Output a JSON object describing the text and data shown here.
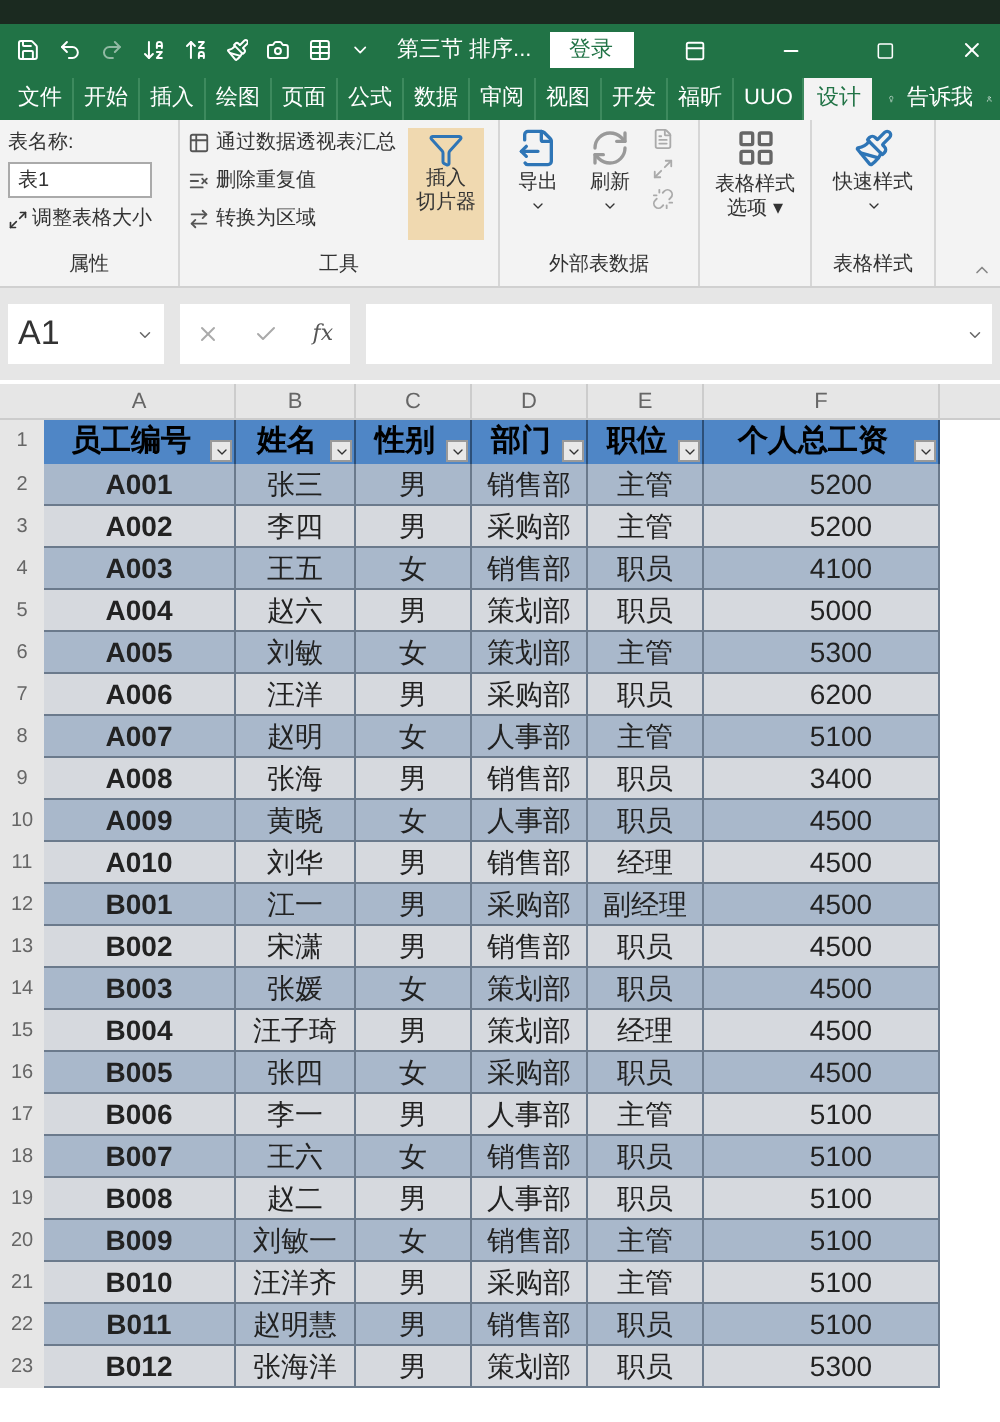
{
  "title_bar": {
    "title": "第三节 排序...",
    "login_button": "登录"
  },
  "ribbon_tabs": [
    {
      "label": "文件",
      "selected": false
    },
    {
      "label": "开始",
      "selected": false
    },
    {
      "label": "插入",
      "selected": false
    },
    {
      "label": "绘图",
      "selected": false
    },
    {
      "label": "页面",
      "selected": false
    },
    {
      "label": "公式",
      "selected": false
    },
    {
      "label": "数据",
      "selected": false
    },
    {
      "label": "审阅",
      "selected": false
    },
    {
      "label": "视图",
      "selected": false
    },
    {
      "label": "开发",
      "selected": false
    },
    {
      "label": "福昕",
      "selected": false
    },
    {
      "label": "UUO",
      "selected": false
    },
    {
      "label": "设计",
      "selected": true
    }
  ],
  "tell_me": "告诉我",
  "ribbon": {
    "properties": {
      "name_label": "表名称:",
      "name_value": "表1",
      "resize": "调整表格大小",
      "group_label": "属性"
    },
    "tools": {
      "items": [
        "通过数据透视表汇总",
        "删除重复值",
        "转换为区域"
      ],
      "slicer_line1": "插入",
      "slicer_line2": "切片器",
      "group_label": "工具"
    },
    "external": {
      "export": "导出",
      "refresh": "刷新",
      "group_label": "外部表数据"
    },
    "style_options": {
      "line1": "表格样式",
      "line2": "选项 ▾"
    },
    "styles": {
      "quick": "快速样式",
      "group_label": "表格样式"
    }
  },
  "formula_bar": {
    "name_box": "A1",
    "function_label": "fx"
  },
  "sheet": {
    "column_letters": [
      "A",
      "B",
      "C",
      "D",
      "E",
      "F"
    ],
    "header_row_number": "1",
    "columns": [
      "员工编号",
      "姓名",
      "性别",
      "部门",
      "职位",
      "个人总工资"
    ],
    "rows": [
      {
        "number": "2",
        "cells": [
          "A001",
          "张三",
          "男",
          "销售部",
          "主管",
          "5200"
        ]
      },
      {
        "number": "3",
        "cells": [
          "A002",
          "李四",
          "男",
          "采购部",
          "主管",
          "5200"
        ]
      },
      {
        "number": "4",
        "cells": [
          "A003",
          "王五",
          "女",
          "销售部",
          "职员",
          "4100"
        ]
      },
      {
        "number": "5",
        "cells": [
          "A004",
          "赵六",
          "男",
          "策划部",
          "职员",
          "5000"
        ]
      },
      {
        "number": "6",
        "cells": [
          "A005",
          "刘敏",
          "女",
          "策划部",
          "主管",
          "5300"
        ]
      },
      {
        "number": "7",
        "cells": [
          "A006",
          "汪洋",
          "男",
          "采购部",
          "职员",
          "6200"
        ]
      },
      {
        "number": "8",
        "cells": [
          "A007",
          "赵明",
          "女",
          "人事部",
          "主管",
          "5100"
        ]
      },
      {
        "number": "9",
        "cells": [
          "A008",
          "张海",
          "男",
          "销售部",
          "职员",
          "3400"
        ]
      },
      {
        "number": "10",
        "cells": [
          "A009",
          "黄晓",
          "女",
          "人事部",
          "职员",
          "4500"
        ]
      },
      {
        "number": "11",
        "cells": [
          "A010",
          "刘华",
          "男",
          "销售部",
          "经理",
          "4500"
        ]
      },
      {
        "number": "12",
        "cells": [
          "B001",
          "江一",
          "男",
          "采购部",
          "副经理",
          "4500"
        ]
      },
      {
        "number": "13",
        "cells": [
          "B002",
          "宋潇",
          "男",
          "销售部",
          "职员",
          "4500"
        ]
      },
      {
        "number": "14",
        "cells": [
          "B003",
          "张媛",
          "女",
          "策划部",
          "职员",
          "4500"
        ]
      },
      {
        "number": "15",
        "cells": [
          "B004",
          "汪子琦",
          "男",
          "策划部",
          "经理",
          "4500"
        ]
      },
      {
        "number": "16",
        "cells": [
          "B005",
          "张四",
          "女",
          "采购部",
          "职员",
          "4500"
        ]
      },
      {
        "number": "17",
        "cells": [
          "B006",
          "李一",
          "男",
          "人事部",
          "主管",
          "5100"
        ]
      },
      {
        "number": "18",
        "cells": [
          "B007",
          "王六",
          "女",
          "销售部",
          "职员",
          "5100"
        ]
      },
      {
        "number": "19",
        "cells": [
          "B008",
          "赵二",
          "男",
          "人事部",
          "职员",
          "5100"
        ]
      },
      {
        "number": "20",
        "cells": [
          "B009",
          "刘敏一",
          "女",
          "销售部",
          "主管",
          "5100"
        ]
      },
      {
        "number": "21",
        "cells": [
          "B010",
          "汪洋齐",
          "男",
          "采购部",
          "主管",
          "5100"
        ]
      },
      {
        "number": "22",
        "cells": [
          "B011",
          "赵明慧",
          "男",
          "销售部",
          "职员",
          "5100"
        ]
      },
      {
        "number": "23",
        "cells": [
          "B012",
          "张海洋",
          "男",
          "策划部",
          "职员",
          "5300"
        ]
      }
    ]
  }
}
